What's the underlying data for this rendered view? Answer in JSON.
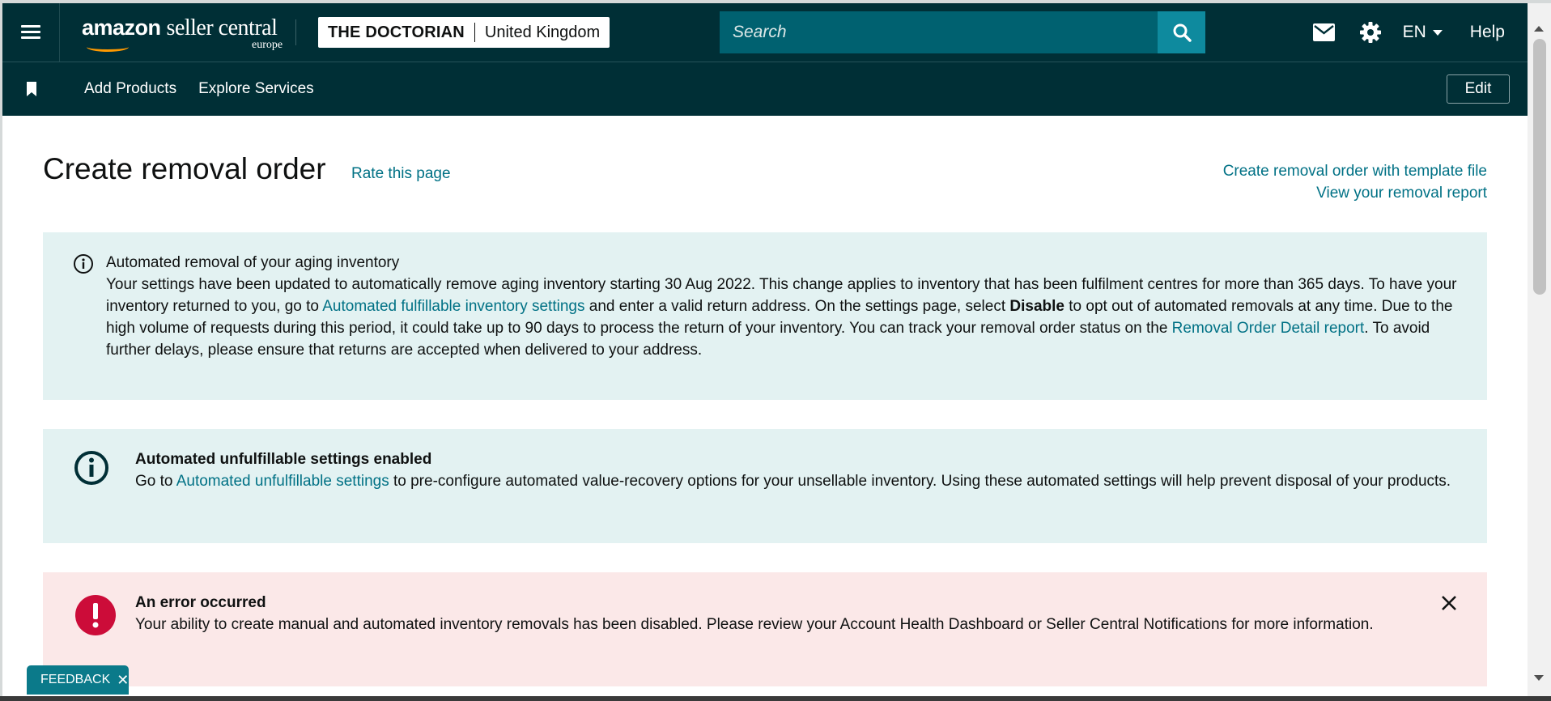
{
  "header": {
    "logo_main": "amazon",
    "logo_sub": "seller central",
    "logo_region": "europe",
    "store_name": "THE DOCTORIAN",
    "marketplace": "United Kingdom",
    "search_placeholder": "Search",
    "language": "EN",
    "help": "Help"
  },
  "subnav": {
    "items": [
      {
        "label": "Add Products"
      },
      {
        "label": "Explore Services"
      }
    ],
    "edit_label": "Edit"
  },
  "page": {
    "title": "Create removal order",
    "rate_link": "Rate this page",
    "template_link": "Create removal order with template file",
    "report_link": "View your removal report"
  },
  "alerts": {
    "aging": {
      "heading": "Automated removal of your aging inventory",
      "text1": "Your settings have been updated to automatically remove aging inventory starting 30 Aug 2022. This change applies to inventory that has been fulfilment centres for more than 365 days. To have your inventory returned to you, go to ",
      "link1": "Automated fulfillable inventory settings",
      "text2": " and enter a valid return address. On the settings page, select ",
      "bold": "Disable",
      "text3": " to opt out of automated removals at any time. Due to the high volume of requests during this period, it could take up to 90 days to process the return of your inventory. You can track your removal order status on the ",
      "link2": "Removal Order Detail report",
      "text4": ". To avoid further delays, please ensure that returns are accepted when delivered to your address."
    },
    "unfulfillable": {
      "heading": "Automated unfulfillable settings enabled",
      "text1": "Go to ",
      "link": "Automated unfulfillable settings",
      "text2": " to pre-configure automated value-recovery options for your unsellable inventory. Using these automated settings will help prevent disposal of your products."
    },
    "error": {
      "heading": "An error occurred",
      "text": "Your ability to create manual and automated inventory removals has been disabled. Please review your Account Health Dashboard or Seller Central Notifications for more information."
    }
  },
  "feedback": {
    "label": "FEEDBACK",
    "close": "✕"
  },
  "colors": {
    "nav_bg": "#002f36",
    "search_bg": "#006170",
    "search_button": "#0e8a9e",
    "link": "#007185",
    "info_bg": "#e3f2f2",
    "error_bg": "#fbe8e8",
    "error_icon": "#cc0c39",
    "smile": "#ff9900"
  },
  "icons": {
    "menu": "hamburger-icon",
    "search": "search-icon",
    "mail": "mail-icon",
    "settings": "gear-icon",
    "bookmark": "bookmark-icon",
    "info": "info-icon",
    "error": "exclamation-icon",
    "close": "close-icon"
  }
}
